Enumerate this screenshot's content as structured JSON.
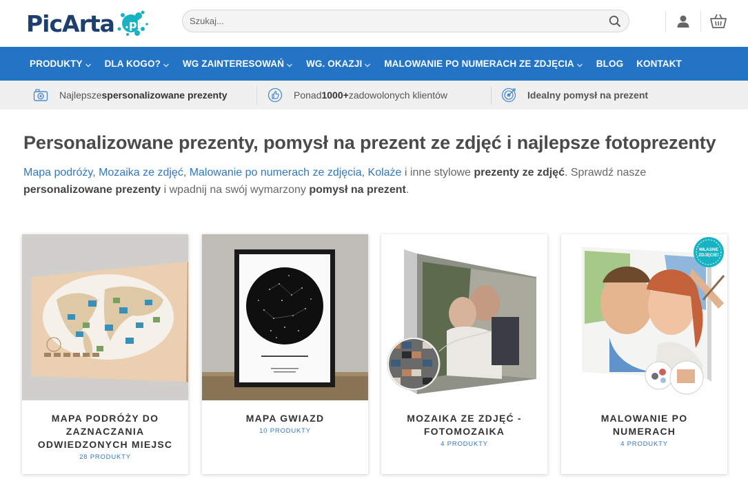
{
  "brand": {
    "logo_text_1": "PicArta",
    "logo_badge": ".pl"
  },
  "search": {
    "placeholder": "Szukaj..."
  },
  "nav": {
    "items": [
      {
        "label": "PRODUKTY",
        "dropdown": true
      },
      {
        "label": "DLA KOGO?",
        "dropdown": true
      },
      {
        "label": "WG ZAINTERESOWAŃ",
        "dropdown": true
      },
      {
        "label": "WG. OKAZJI",
        "dropdown": true
      },
      {
        "label": "MALOWANIE PO NUMERACH ZE ZDJĘCIA",
        "dropdown": true
      },
      {
        "label": "BLOG",
        "dropdown": false
      },
      {
        "label": "KONTAKT",
        "dropdown": false
      }
    ]
  },
  "benefits": [
    {
      "pre": "Najlepsze ",
      "bold": "spersonalizowane prezenty",
      "post": ""
    },
    {
      "pre": "Ponad ",
      "bold": "1000+",
      "post": " zadowolonych klientów"
    },
    {
      "pre": "",
      "bold": "Idealny pomysł na prezent",
      "post": ""
    }
  ],
  "page": {
    "title": "Personalizowane prezenty, pomysł na prezent ze zdjęć i najlepsze fotoprezenty",
    "intro": {
      "link1": "Mapa podróży",
      "sep1": ", ",
      "link2": "Mozaika ze zdjęć",
      "sep2": ", ",
      "link3": "Malowanie po numerach ze zdjęcia",
      "sep3": ", ",
      "link4": "Kolaże",
      "t1": " i inne stylowe ",
      "b1": "prezenty ze zdjęć",
      "t2": ". Sprawdź nasze ",
      "b2": "personalizowane prezenty",
      "t3": " i wpadnij na swój wymarzony ",
      "b3": "pomysł na prezent",
      "t4": "."
    }
  },
  "categories": [
    {
      "title": "MAPA PODRÓŻY DO ZAZNACZANIA ODWIEDZONYCH MIEJSC",
      "count": "28 PRODUKTY"
    },
    {
      "title": "MAPA GWIAZD",
      "count": "10 PRODUKTY"
    },
    {
      "title": "MOZAIKA ZE ZDJĘĆ - FOTOMOZAIKA",
      "count": "4 PRODUKTY"
    },
    {
      "title": "MALOWANIE PO NUMERACH",
      "count": "4 PRODUKTY",
      "badge": "WŁASNE ZDJĘCIE!"
    }
  ],
  "colors": {
    "nav_bg": "#2474c6",
    "link": "#2f78c4",
    "logo_dark": "#1c3f6e",
    "accent_teal": "#18b3c2"
  },
  "icons": [
    "search-icon",
    "user-icon",
    "cart-icon",
    "chevron-down-icon",
    "camera-icon",
    "thumbs-up-icon",
    "target-icon"
  ]
}
